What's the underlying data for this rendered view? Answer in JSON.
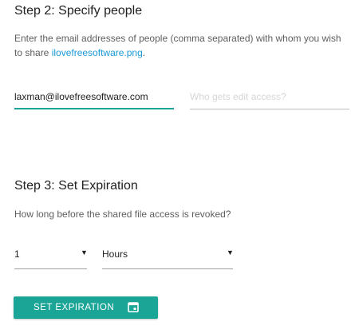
{
  "step2": {
    "title": "Step 2: Specify people",
    "description_prefix": "Enter the email addresses of people (comma separated) with whom you wish to share ",
    "file_name": "ilovefreesoftware.png",
    "description_suffix": ".",
    "email_value": "laxman@ilovefreesoftware.com",
    "edit_access_placeholder": "Who gets edit access?"
  },
  "step3": {
    "title": "Step 3: Set Expiration",
    "description": "How long before the shared file access is revoked?",
    "duration_value": "1",
    "unit_value": "Hours",
    "set_expiration_label": "SET EXPIRATION",
    "calendar_icon": "calendar-icon"
  },
  "colors": {
    "accent": "#1ba597",
    "link": "#1a9ad6"
  }
}
